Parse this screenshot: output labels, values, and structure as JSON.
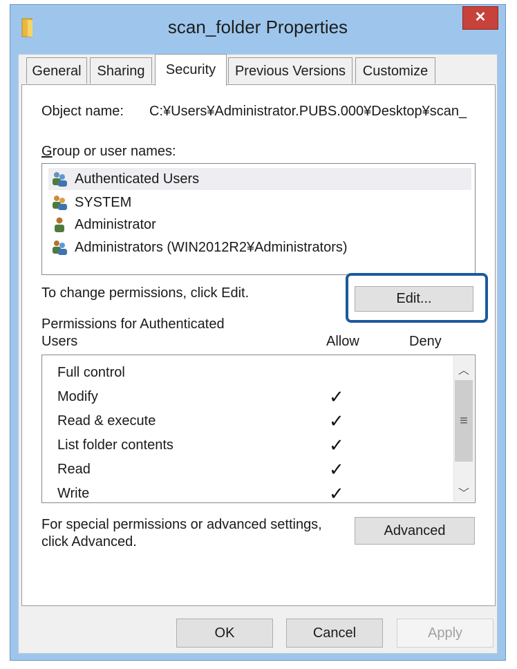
{
  "window": {
    "title": "scan_folder Properties",
    "close_label": "✕"
  },
  "tabs": [
    {
      "label": "General",
      "active": false
    },
    {
      "label": "Sharing",
      "active": false
    },
    {
      "label": "Security",
      "active": true
    },
    {
      "label": "Previous Versions",
      "active": false
    },
    {
      "label": "Customize",
      "active": false
    }
  ],
  "security": {
    "object_name_label": "Object name:",
    "object_name_value": "C:¥Users¥Administrator.PUBS.000¥Desktop¥scan_",
    "group_label": "Group or user names:",
    "users": [
      {
        "label": "Authenticated Users",
        "icon": "user-group-icon",
        "selected": true
      },
      {
        "label": "SYSTEM",
        "icon": "user-group-icon",
        "selected": false
      },
      {
        "label": "Administrator",
        "icon": "user-icon",
        "selected": false
      },
      {
        "label": "Administrators (WIN2012R2¥Administrators)",
        "icon": "user-group-icon",
        "selected": false
      }
    ],
    "change_text": "To change permissions, click Edit.",
    "edit_label": "Edit...",
    "permissions_label_line1": "Permissions for Authenticated",
    "permissions_label_line2": "Users",
    "allow_header": "Allow",
    "deny_header": "Deny",
    "permissions": [
      {
        "name": "Full control",
        "allow": "",
        "deny": ""
      },
      {
        "name": "Modify",
        "allow": "✓",
        "deny": ""
      },
      {
        "name": "Read & execute",
        "allow": "✓",
        "deny": ""
      },
      {
        "name": "List folder contents",
        "allow": "✓",
        "deny": ""
      },
      {
        "name": "Read",
        "allow": "✓",
        "deny": ""
      },
      {
        "name": "Write",
        "allow": "✓",
        "deny": ""
      }
    ],
    "special_line1": "For special permissions or advanced settings,",
    "special_line2": "click Advanced.",
    "advanced_label": "Advanced"
  },
  "footer": {
    "ok_label": "OK",
    "cancel_label": "Cancel",
    "apply_label": "Apply"
  },
  "colors": {
    "accent": "#1c5a9c",
    "title_bar": "#9ec6ec",
    "close": "#c7423a"
  }
}
